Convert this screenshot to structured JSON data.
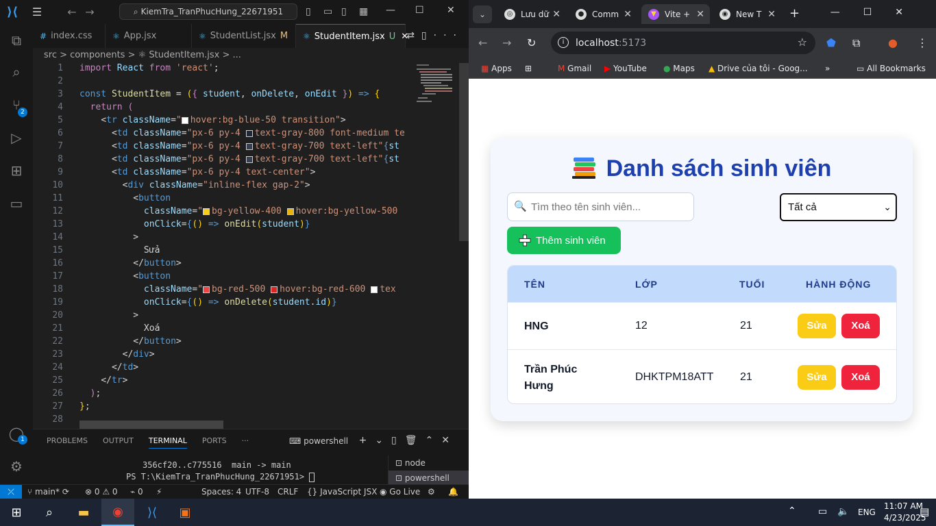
{
  "vscode": {
    "search": "KiemTra_TranPhucHung_22671951",
    "tabs": [
      {
        "label": "index.css",
        "icon": "#"
      },
      {
        "label": "App.jsx",
        "icon": "⚛"
      },
      {
        "label": "StudentList.jsx",
        "icon": "⚛",
        "mod": "M"
      },
      {
        "label": "StudentItem.jsx",
        "icon": "⚛",
        "mod": "U"
      }
    ],
    "breadcrumb": "src > components > ⚛ StudentItem.jsx > ...",
    "line_numbers": [
      "1",
      "2",
      "3",
      "4",
      "5",
      "6",
      "7",
      "8",
      "9",
      "10",
      "11",
      "12",
      "13",
      "14",
      "15",
      "16",
      "17",
      "18",
      "19",
      "20",
      "21",
      "22",
      "23",
      "24",
      "25",
      "26",
      "27",
      "28"
    ],
    "panel": {
      "tabs": [
        "PROBLEMS",
        "OUTPUT",
        "TERMINAL",
        "PORTS",
        "···"
      ],
      "shell": "powershell",
      "term_line1": "356cf20..c775516  main -> main",
      "term_line2": "PS T:\\KiemTra_TranPhucHung_22671951> ",
      "term_list": [
        "node",
        "powershell"
      ]
    },
    "status": {
      "branch": "main*",
      "errors": "0",
      "warnings": "0",
      "ports": "0",
      "spaces": "Spaces: 4",
      "encoding": "UTF-8",
      "eol": "CRLF",
      "lang": "JavaScript JSX",
      "golive": "Go Live"
    },
    "badges": {
      "scm": "2",
      "accounts": "1"
    }
  },
  "chrome": {
    "tabs": [
      {
        "label": "Lưu dữ"
      },
      {
        "label": "Comm"
      },
      {
        "label": "Vite +"
      },
      {
        "label": "New T"
      }
    ],
    "url_host": "localhost",
    "url_port": ":5173",
    "bookmarks": [
      "Apps",
      "Gmail",
      "YouTube",
      "Maps",
      "Drive của tôi - Goog...",
      "»",
      "All Bookmarks"
    ]
  },
  "app": {
    "title": "Danh sách sinh viên",
    "search_placeholder": "Tìm theo tên sinh viên...",
    "filter_value": "Tất cả",
    "add_label": "Thêm sinh viên",
    "headers": [
      "TÊN",
      "LỚP",
      "TUỔI",
      "HÀNH ĐỘNG"
    ],
    "rows": [
      {
        "name": "HNG",
        "class": "12",
        "age": "21"
      },
      {
        "name": "Trần Phúc Hưng",
        "class": "DHKTPM18ATT",
        "age": "21"
      }
    ],
    "edit_label": "Sửa",
    "delete_label": "Xoá"
  },
  "taskbar": {
    "lang": "ENG",
    "time": "11:07 AM",
    "date": "4/23/2025"
  }
}
